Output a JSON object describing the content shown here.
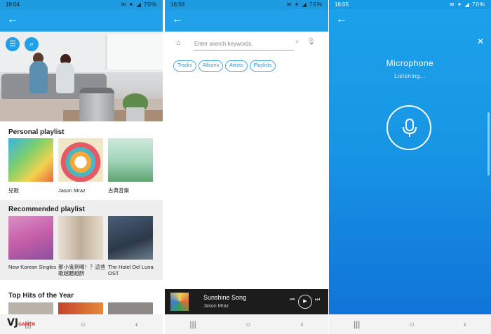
{
  "phone1": {
    "status": {
      "time": "18:04",
      "battery": "70%"
    },
    "sections": [
      {
        "title": "Personal playlist",
        "items": [
          {
            "caption": "兒歌"
          },
          {
            "caption": "Jason Mraz"
          },
          {
            "caption": "古典音樂"
          }
        ]
      },
      {
        "title": "Recommended playlist",
        "items": [
          {
            "caption": "New Korean Singles"
          },
          {
            "caption": "那小鬼到哪！？這些歌越聽越醉"
          },
          {
            "caption": "The Hotel Del Luna OST"
          }
        ]
      },
      {
        "title": "Top Hits of the Year"
      }
    ],
    "watermark": {
      "main": "VJ",
      "sub": "GAMER"
    }
  },
  "phone2": {
    "status": {
      "time": "16:58",
      "battery": "75%"
    },
    "search_placeholder": "Enter search keywords.",
    "chips": [
      "Tracks",
      "Albums",
      "Artists",
      "Playlists"
    ],
    "player": {
      "title": "Sunshine Song",
      "artist": "Jason Mraz"
    }
  },
  "phone3": {
    "status": {
      "time": "18:05",
      "battery": "70%"
    },
    "title": "Microphone",
    "subtitle": "Listening..."
  },
  "icons": {
    "back": "arrow-left",
    "menu": "hamburger",
    "search": "magnifier",
    "home": "house",
    "mic": "microphone",
    "close": "x",
    "nav_recent": "three-bars",
    "nav_home": "circle",
    "nav_back": "chevron-left"
  },
  "colors": {
    "accent": "#1fa0e8",
    "chip": "#2a94d6",
    "player_bg": "#1c1c1c"
  }
}
